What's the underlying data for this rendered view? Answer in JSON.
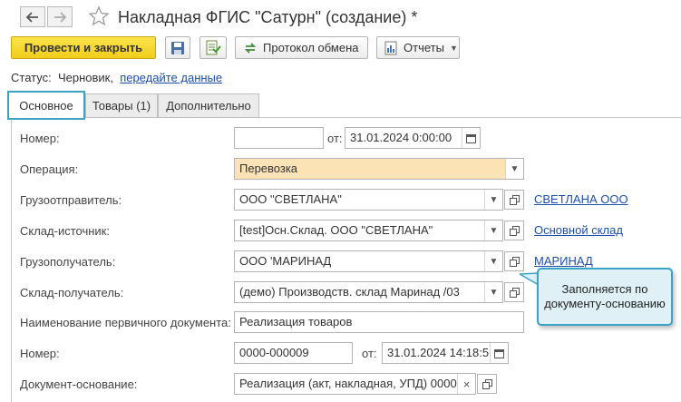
{
  "window": {
    "title": "Накладная ФГИС \"Сатурн\" (создание) *"
  },
  "toolbar": {
    "post_close_label": "Провести и закрыть",
    "exchange_protocol_label": "Протокол обмена",
    "reports_label": "Отчеты"
  },
  "status": {
    "label": "Статус:",
    "value": "Черновик,",
    "link": "передайте данные"
  },
  "tabs": [
    {
      "label": "Основное",
      "active": true
    },
    {
      "label": "Товары (1)",
      "active": false
    },
    {
      "label": "Дополнительно",
      "active": false
    }
  ],
  "form": {
    "number": {
      "label": "Номер:",
      "value": "",
      "from_label": "от:",
      "date": "31.01.2024  0:00:00"
    },
    "operation": {
      "label": "Операция:",
      "value": "Перевозка"
    },
    "shipper": {
      "label": "Грузоотправитель:",
      "value": "ООО \"СВЕТЛАНА\"",
      "link": "СВЕТЛАНА ООО"
    },
    "source_warehouse": {
      "label": "Склад-источник:",
      "value": "[test]Осн.Склад. ООО \"СВЕТЛАНА\"",
      "link": "Основной склад"
    },
    "consignee": {
      "label": "Грузополучатель:",
      "value": "ООО  'МАРИНАД",
      "link": "МАРИНАД"
    },
    "dest_warehouse": {
      "label": "Склад-получатель:",
      "value": "(демо) Производств. склад  Маринад /03"
    },
    "primary_doc_name": {
      "label": "Наименование первичного документа:",
      "value": "Реализация товаров"
    },
    "primary_doc_number": {
      "label": "Номер:",
      "value": "0000-000009",
      "from_label": "от:",
      "date": "31.01.2024 14:18:5"
    },
    "base_doc": {
      "label": "Документ-основание:",
      "value": "Реализация (акт, накладная, УПД) 0000-"
    }
  },
  "callout": {
    "text": "Заполняется по документу-основанию"
  },
  "colors": {
    "accent": "#3aa3c7",
    "primary_button": "#f2cd1d",
    "operation_field": "#fbe3b6",
    "link": "#1f4ea8"
  }
}
